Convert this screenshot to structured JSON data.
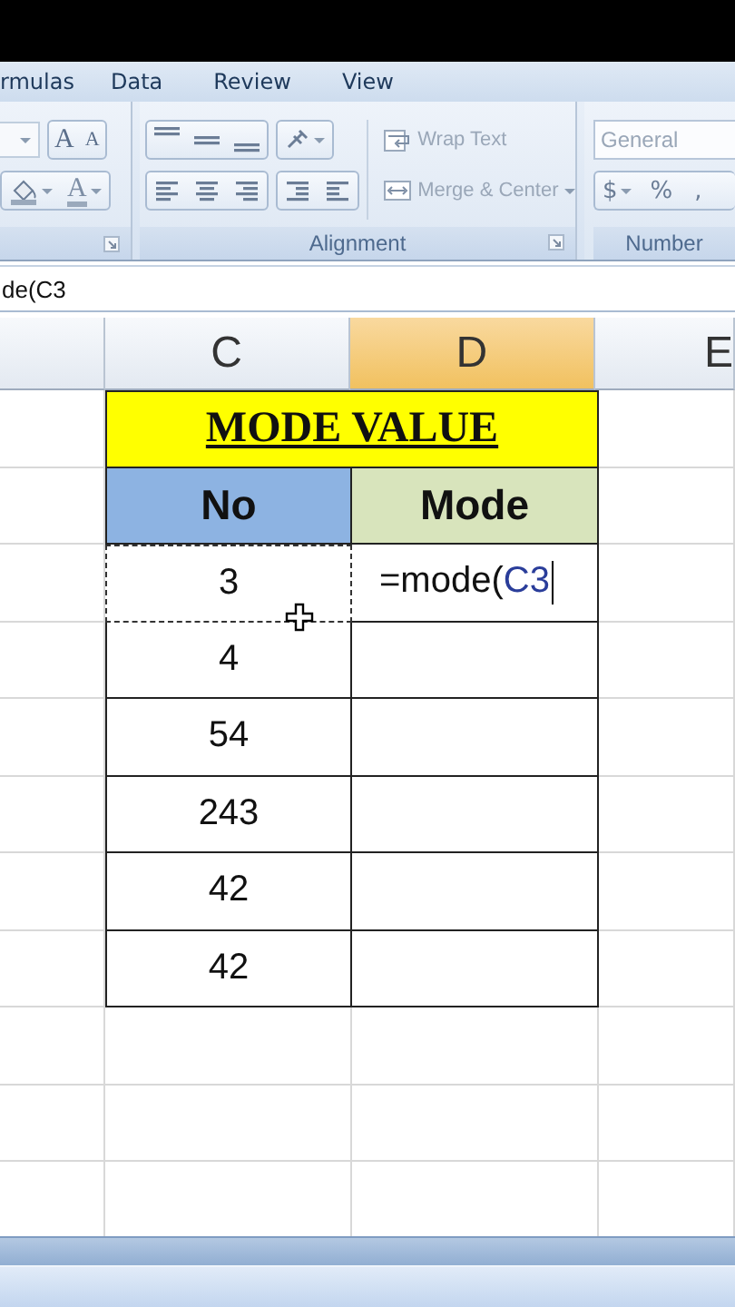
{
  "ribbon_tabs": [
    {
      "label": "rmulas",
      "selected": false
    },
    {
      "label": "Data",
      "selected": false
    },
    {
      "label": "Review",
      "selected": false
    },
    {
      "label": "View",
      "selected": false
    }
  ],
  "font_group": {
    "grow_label": "A",
    "shrink_label": "A",
    "color_label": "A"
  },
  "alignment_group": {
    "title": "Alignment",
    "wrap_text": {
      "label": "Wrap Text",
      "disabled": true
    },
    "merge_center": {
      "label": "Merge & Center",
      "disabled": true
    }
  },
  "number_group": {
    "title": "Number",
    "format": "General",
    "currency": "$",
    "percent": "%",
    "comma": ","
  },
  "formula_bar": {
    "value": "de(C3"
  },
  "columns": [
    {
      "label": "C",
      "selected": false
    },
    {
      "label": "D",
      "selected": true
    },
    {
      "label": "E",
      "selected": false
    }
  ],
  "title": "MODE VALUE",
  "headers": [
    {
      "label": "No",
      "color": "#8db3e2"
    },
    {
      "label": "Mode",
      "color": "#d8e4bc"
    }
  ],
  "rows": [
    {
      "value": "3",
      "marquee": true,
      "formula": {
        "text": "=mode(",
        "reference": "C3"
      }
    },
    {
      "value": "4",
      "marquee": false
    },
    {
      "value": "54",
      "marquee": false
    },
    {
      "value": "243",
      "marquee": false
    },
    {
      "value": "42",
      "marquee": false
    },
    {
      "value": "42",
      "marquee": false
    }
  ]
}
